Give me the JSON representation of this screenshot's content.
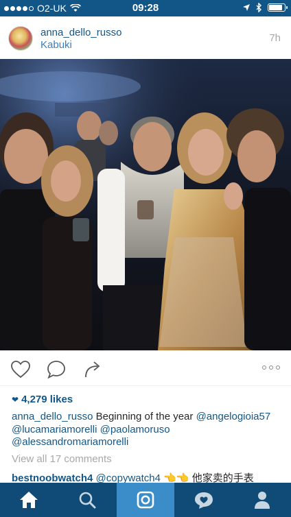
{
  "status_bar": {
    "carrier": "O2-UK",
    "time": "09:28",
    "battery_level": 0.95
  },
  "post": {
    "username": "anna_dello_russo",
    "location": "Kabuki",
    "time_ago": "7h",
    "photo_icon": "party-photo",
    "likes": "4,279 likes",
    "caption": {
      "username": "anna_dello_russo",
      "text": "Beginning of the year",
      "tags": [
        "@angelogioia57",
        "@lucamariamorelli",
        "@paolamoruso",
        "@alessandromariamorelli"
      ]
    },
    "view_all_comments": "View all 17 comments",
    "comment": {
      "username": "bestnoobwatch4",
      "tag": "@copywatch4",
      "text": "他家卖的手表"
    }
  },
  "tab_bar": {
    "tabs": [
      {
        "icon": "home-icon",
        "active": false
      },
      {
        "icon": "search-icon",
        "active": false
      },
      {
        "icon": "camera-icon",
        "active": true
      },
      {
        "icon": "activity-icon",
        "active": false
      },
      {
        "icon": "profile-icon",
        "active": false
      }
    ]
  },
  "colors": {
    "status_bar": "#125688",
    "link": "#125688",
    "tab_bar": "#0f4b76",
    "tab_active": "#3a8dc9"
  }
}
